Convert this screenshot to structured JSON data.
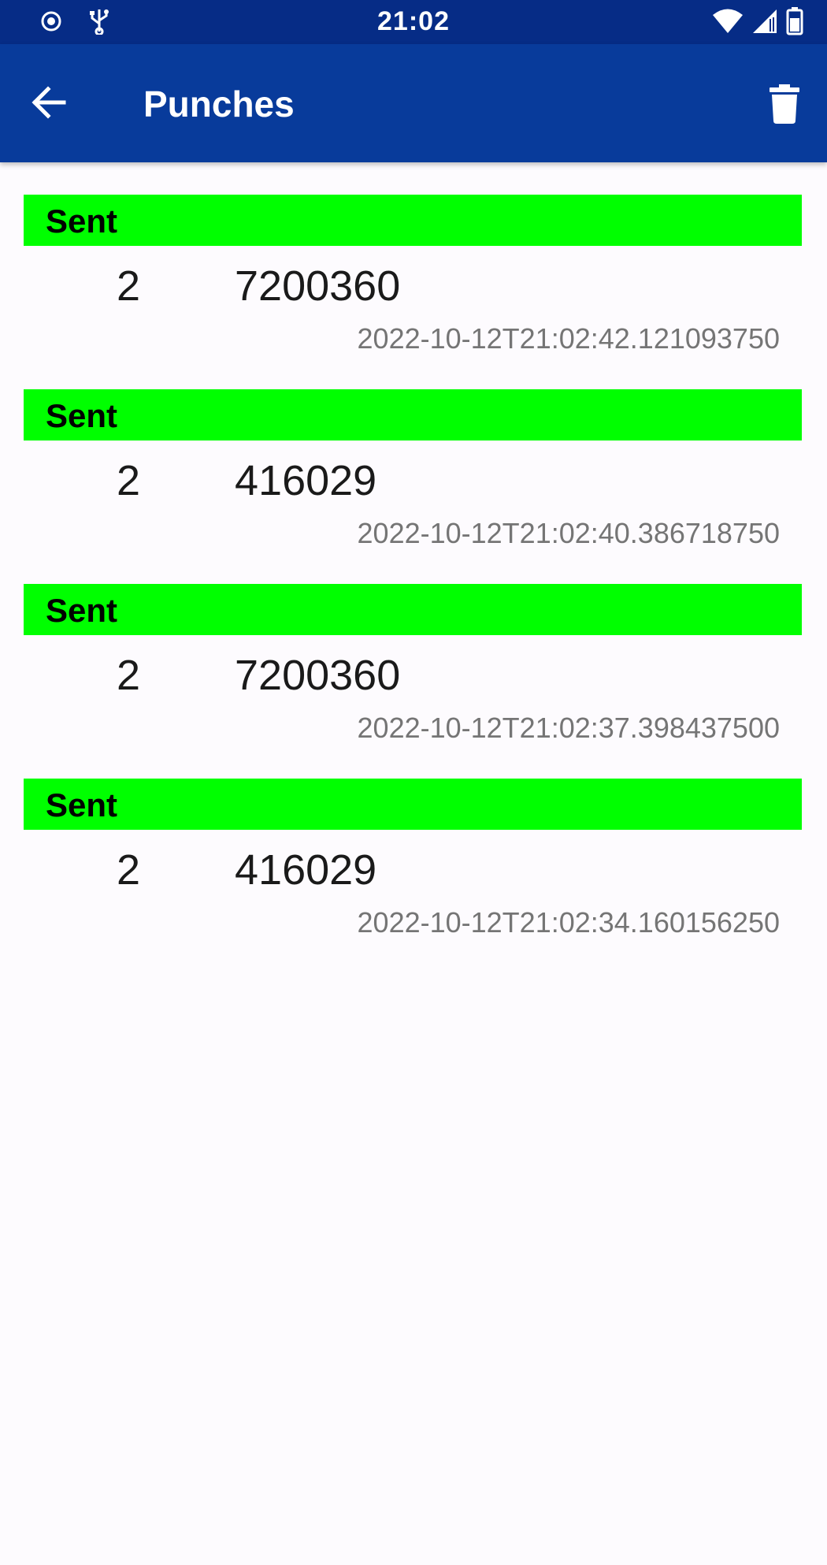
{
  "status_bar": {
    "time": "21:02",
    "left_icons": [
      "record-icon",
      "usb-icon"
    ],
    "right_icons": [
      "wifi-icon",
      "signal-icon",
      "battery-icon"
    ]
  },
  "app_bar": {
    "title": "Punches",
    "back_icon": "arrow-left-icon",
    "action_icon": "trash-icon",
    "background": "#083b9b"
  },
  "status_color": "#00ff00",
  "punches": [
    {
      "status": "Sent",
      "number": "2",
      "code": "7200360",
      "timestamp": "2022-10-12T21:02:42.121093750"
    },
    {
      "status": "Sent",
      "number": "2",
      "code": "416029",
      "timestamp": "2022-10-12T21:02:40.386718750"
    },
    {
      "status": "Sent",
      "number": "2",
      "code": "7200360",
      "timestamp": "2022-10-12T21:02:37.398437500"
    },
    {
      "status": "Sent",
      "number": "2",
      "code": "416029",
      "timestamp": "2022-10-12T21:02:34.160156250"
    }
  ]
}
